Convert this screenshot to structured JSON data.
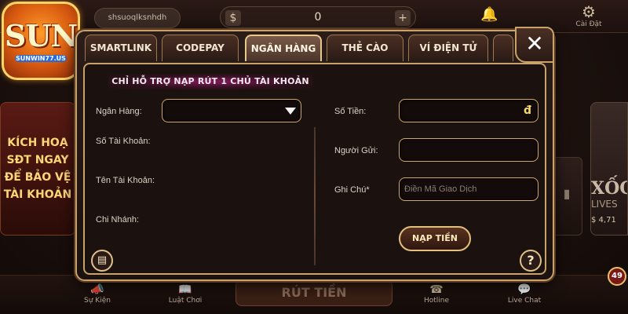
{
  "background": {
    "logo": {
      "main": "SUN",
      "sub": "SUNWIN77.US"
    },
    "username": "shsuoqlksnhdh",
    "balance": {
      "currency_icon": "$",
      "value": "0",
      "plus": "+"
    },
    "settings_label": "Cài Đặt",
    "promo_left": [
      "KÍCH HOẠ",
      "SĐT NGAY",
      "ĐỂ BẢO VỆ",
      "TÀI KHOẢN"
    ],
    "promo_right": {
      "title": "XỐC",
      "sub": "LIVES",
      "count": "$ 4,71"
    },
    "bottom_nav": [
      "Sự Kiện",
      "Luật Chơi",
      "Hotline",
      "Live Chat"
    ],
    "bottom_center": "RÚT TIỀN",
    "badge_count": "49"
  },
  "modal": {
    "tabs": [
      "SMARTLINK",
      "CODEPAY",
      "NGÂN HÀNG",
      "THẺ CÀO",
      "VÍ ĐIỆN TỬ"
    ],
    "active_tab_index": 2,
    "close_label": "✕",
    "notice": "CHỈ HỖ TRỢ NẠP RÚT 1 CHỦ TÀI KHOẢN",
    "left": {
      "bank_label": "Ngân Hàng:",
      "bank_value": "",
      "account_number_label": "Số Tài Khoản:",
      "account_name_label": "Tên Tài Khoản:",
      "branch_label": "Chi Nhánh:"
    },
    "right": {
      "amount_label": "Số Tiền:",
      "amount_currency": "đ",
      "sender_label": "Người Gửi:",
      "note_label": "Ghi Chú*",
      "note_placeholder": "Điền Mã Giao Dịch"
    },
    "submit_label": "NẠP TIỀN",
    "help_label": "?"
  }
}
